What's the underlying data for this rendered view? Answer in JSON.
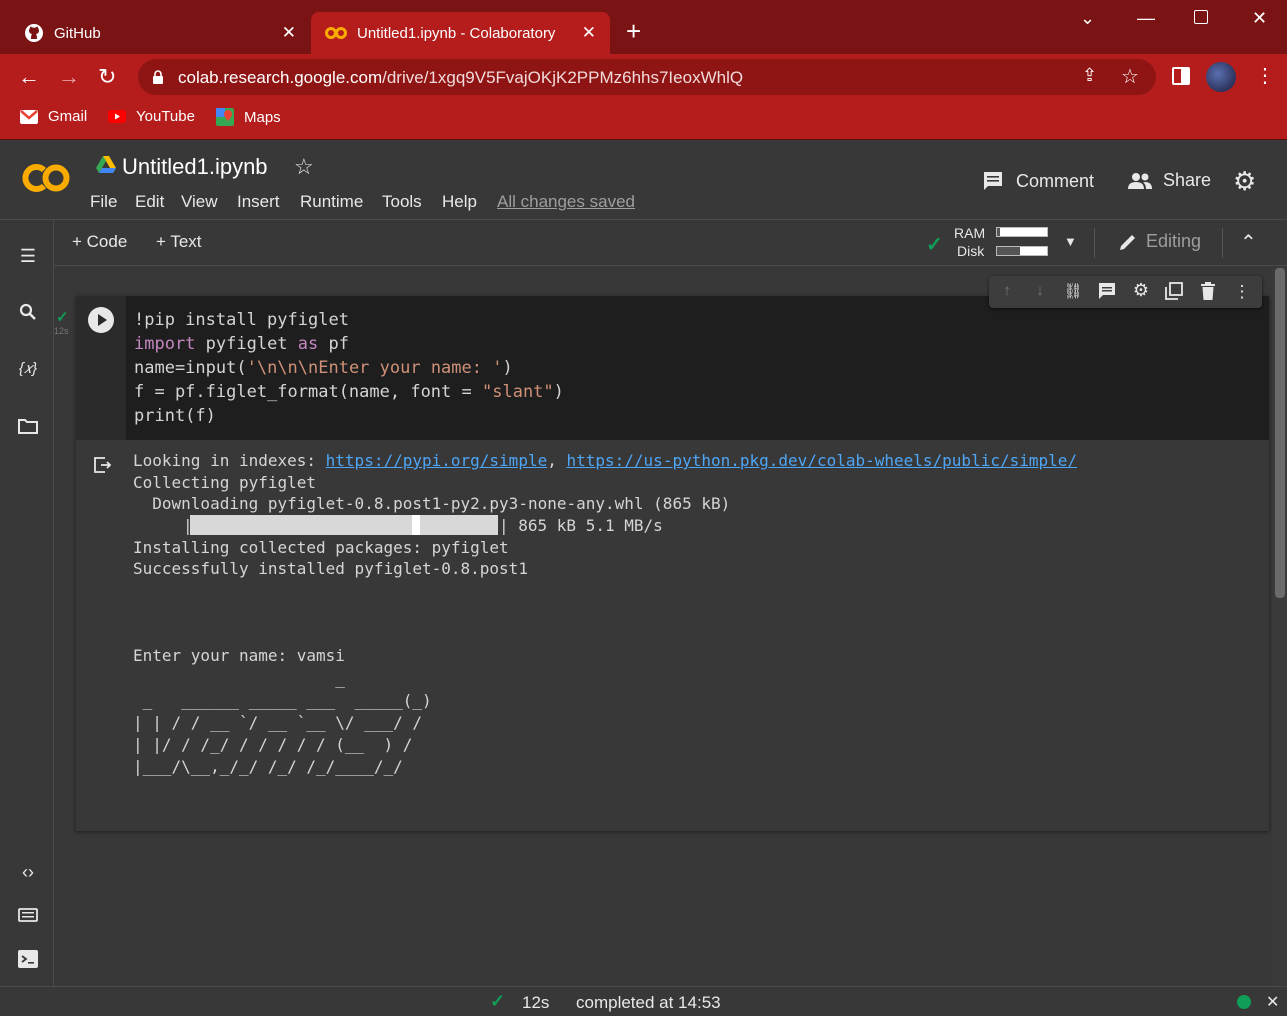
{
  "browser": {
    "tabs": [
      {
        "label": "GitHub",
        "active": false
      },
      {
        "label": "Untitled1.ipynb - Colaboratory",
        "active": true
      }
    ],
    "url_host": "colab.research.google.com",
    "url_path": "/drive/1xgq9V5FvajOKjK2PPMz6hhs7IeoxWhlQ",
    "bookmarks": [
      "Gmail",
      "YouTube",
      "Maps"
    ]
  },
  "colab": {
    "notebook_title": "Untitled1.ipynb",
    "menu": [
      "File",
      "Edit",
      "View",
      "Insert",
      "Runtime",
      "Tools",
      "Help"
    ],
    "save_status": "All changes saved",
    "comment_label": "Comment",
    "share_label": "Share",
    "add_code_label": "+ Code",
    "add_text_label": "+ Text",
    "ram_label": "RAM",
    "disk_label": "Disk",
    "editing_label": "Editing",
    "ram_usage": 0.05,
    "disk_usage": 0.45
  },
  "cell": {
    "exec_time": "12s",
    "code_lines": [
      "!pip install pyfiglet",
      "import pyfiglet as pf",
      "name=input('\\n\\n\\nEnter your name: ')",
      "f = pf.figlet_format(name, font = \"slant\")",
      "print(f)"
    ],
    "output": {
      "index_prefix": "Looking in indexes: ",
      "index_link1": "https://pypi.org/simple",
      "index_sep": ", ",
      "index_link2": "https://us-python.pkg.dev/colab-wheels/public/simple/",
      "collecting": "Collecting pyfiglet",
      "downloading": "  Downloading pyfiglet-0.8.post1-py2.py3-none-any.whl (865 kB)",
      "progress_suffix": "| 865 kB 5.1 MB/s",
      "installing": "Installing collected packages: pyfiglet",
      "success": "Successfully installed pyfiglet-0.8.post1",
      "prompt": "Enter your name: vamsi",
      "ascii_art": [
        "                     _ ",
        " _   ______ _____ ___  _____(_)",
        "| | / / __ `/ __ `__ \\/ ___/ /",
        "| |/ / /_/ / / / / / (__  ) / ",
        "|___/\\__,_/_/ /_/ /_/____/_/  "
      ]
    }
  },
  "status": {
    "time": "12s",
    "completed": "completed at 14:53"
  },
  "colors": {
    "tabbar": "#7a1414",
    "toolbar_red": "#b51c1c",
    "colab_bg": "#383838",
    "code_bg": "#1e1e1e",
    "link": "#4ea6f6",
    "ok_green": "#0f9d58"
  }
}
